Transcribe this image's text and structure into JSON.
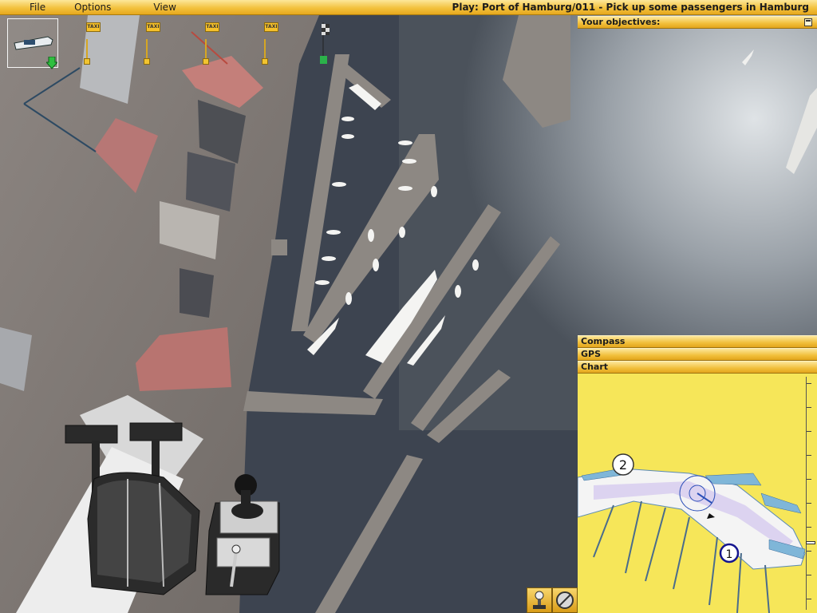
{
  "menu": {
    "file_label": "File",
    "options_label": "Options",
    "view_label": "View"
  },
  "window": {
    "title": "Play: Port of Hamburg/011 - Pick up some passengers in Hamburg"
  },
  "objectives_panel": {
    "title": "Your objectives:"
  },
  "instrument_panels": {
    "compass_label": "Compass",
    "gps_label": "GPS",
    "chart_label": "Chart"
  },
  "taxi_signs": [
    "TAXI",
    "TAXI",
    "TAXI",
    "TAXI"
  ],
  "chart_markers": {
    "waypoint_2": "2",
    "waypoint_1": "1"
  },
  "icons": {
    "anchor_button": "anchor-icon",
    "no_entry_button": "no-entry-icon",
    "finish_flag": "checkered-flag-icon",
    "waypoint_arrow": "green-arrow-icon"
  },
  "colors": {
    "ui_accent": "#f3c23f",
    "chart_land": "#f6e659",
    "water": "#3f4652",
    "quay": "#8e8984"
  },
  "controls": {
    "throttle_level": 0.5,
    "bow_thruster_level": 0.5
  }
}
